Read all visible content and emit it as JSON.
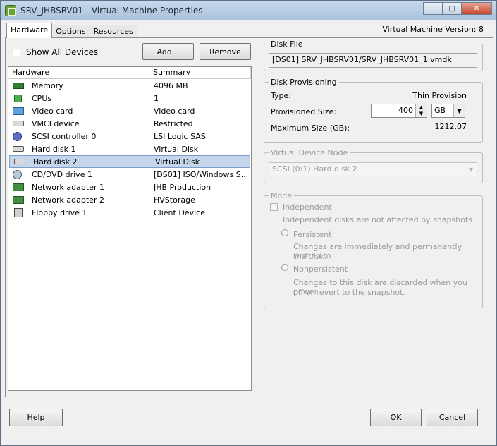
{
  "window": {
    "title": "SRV_JHBSRV01 - Virtual Machine Properties",
    "caption": {
      "minimize": "─",
      "maximize": "□",
      "close": "✕"
    }
  },
  "tabs": [
    {
      "label": "Hardware",
      "active": true
    },
    {
      "label": "Options",
      "active": false
    },
    {
      "label": "Resources",
      "active": false
    }
  ],
  "vm_version": "Virtual Machine Version: 8",
  "hardware_panel": {
    "show_all_label": "Show All Devices",
    "add_label": "Add...",
    "remove_label": "Remove",
    "columns": [
      "Hardware",
      "Summary"
    ],
    "rows": [
      {
        "name": "Memory",
        "summary": "4096 MB",
        "icon": "memory-icon"
      },
      {
        "name": "CPUs",
        "summary": "1",
        "icon": "cpu-icon"
      },
      {
        "name": "Video card",
        "summary": "Video card",
        "icon": "video-card-icon"
      },
      {
        "name": "VMCI device",
        "summary": "Restricted",
        "icon": "vmci-device-icon"
      },
      {
        "name": "SCSI controller 0",
        "summary": "LSI Logic SAS",
        "icon": "scsi-controller-icon"
      },
      {
        "name": "Hard disk 1",
        "summary": "Virtual Disk",
        "icon": "hard-disk-icon"
      },
      {
        "name": "Hard disk 2",
        "summary": "Virtual Disk",
        "icon": "hard-disk-icon",
        "selected": true
      },
      {
        "name": "CD/DVD drive 1",
        "summary": "[DS01] ISO/Windows S...",
        "icon": "cd-dvd-icon"
      },
      {
        "name": "Network adapter 1",
        "summary": "JHB Production",
        "icon": "network-adapter-icon"
      },
      {
        "name": "Network adapter 2",
        "summary": "HVStorage",
        "icon": "network-adapter-icon"
      },
      {
        "name": "Floppy drive 1",
        "summary": "Client Device",
        "icon": "floppy-drive-icon"
      }
    ]
  },
  "disk_file": {
    "legend": "Disk File",
    "value": "[DS01] SRV_JHBSRV01/SRV_JHBSRV01_1.vmdk"
  },
  "disk_provisioning": {
    "legend": "Disk Provisioning",
    "type_label": "Type:",
    "type_value": "Thin Provision",
    "provisioned_label": "Provisioned Size:",
    "provisioned_value": "400",
    "unit": "GB",
    "max_label": "Maximum Size (GB):",
    "max_value": "1212.07"
  },
  "virtual_device_node": {
    "legend": "Virtual Device Node",
    "value": "SCSI (0:1) Hard disk 2"
  },
  "mode": {
    "legend": "Mode",
    "independent_label": "Independent",
    "independent_desc": "Independent disks are not affected by snapshots.",
    "persistent_label": "Persistent",
    "persistent_desc_1": "Changes are immediately and permanently written to",
    "persistent_desc_2": "the disk.",
    "nonpersistent_label": "Nonpersistent",
    "nonpersistent_desc_1": "Changes to this disk are discarded when you power",
    "nonpersistent_desc_2": "off or revert to the snapshot."
  },
  "footer": {
    "help": "Help",
    "ok": "OK",
    "cancel": "Cancel"
  }
}
